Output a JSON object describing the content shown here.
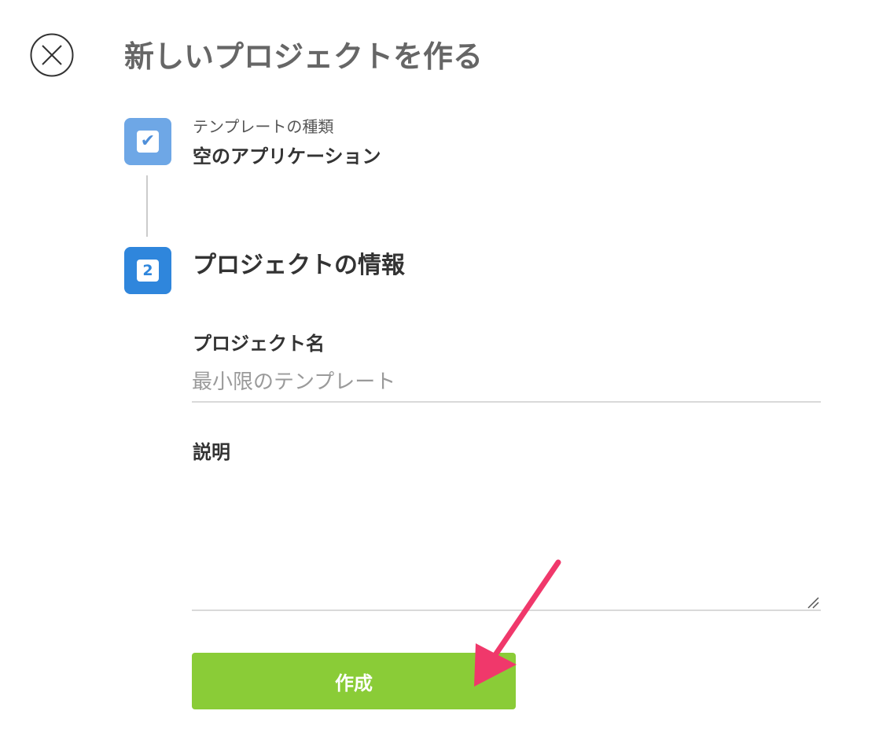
{
  "header": {
    "title": "新しいプロジェクトを作る",
    "close_icon": "close-circle-icon"
  },
  "steps": [
    {
      "badge_icon": "check-icon",
      "badge_glyph": "✔",
      "caption": "テンプレートの種類",
      "value": "空のアプリケーション",
      "status": "completed"
    },
    {
      "badge_number": "2",
      "title": "プロジェクトの情報",
      "status": "active"
    }
  ],
  "form": {
    "project_name": {
      "label": "プロジェクト名",
      "value": "",
      "placeholder": "最小限のテンプレート"
    },
    "description": {
      "label": "説明",
      "value": "",
      "placeholder": ""
    },
    "submit_label": "作成"
  },
  "annotation": {
    "arrow_icon": "pointer-arrow-icon",
    "arrow_color": "#f0386b"
  },
  "colors": {
    "step_completed": "#6ea7e6",
    "step_active": "#2f86dc",
    "primary_button": "#8acc37",
    "title_text": "#666666"
  }
}
